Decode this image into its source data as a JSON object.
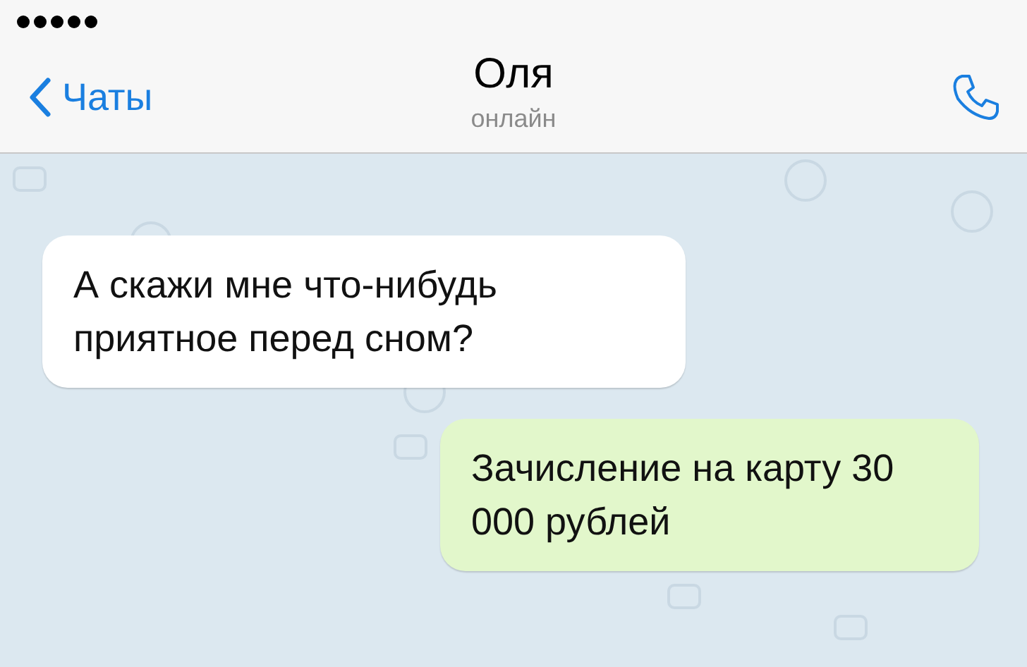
{
  "header": {
    "back_label": "Чаты",
    "title": "Оля",
    "subtitle": "онлайн"
  },
  "messages": [
    {
      "kind": "incoming",
      "text": "А скажи мне что-нибудь приятное перед сном?"
    },
    {
      "kind": "outgoing",
      "text": "Зачисление на карту 30 000 рублей"
    }
  ]
}
